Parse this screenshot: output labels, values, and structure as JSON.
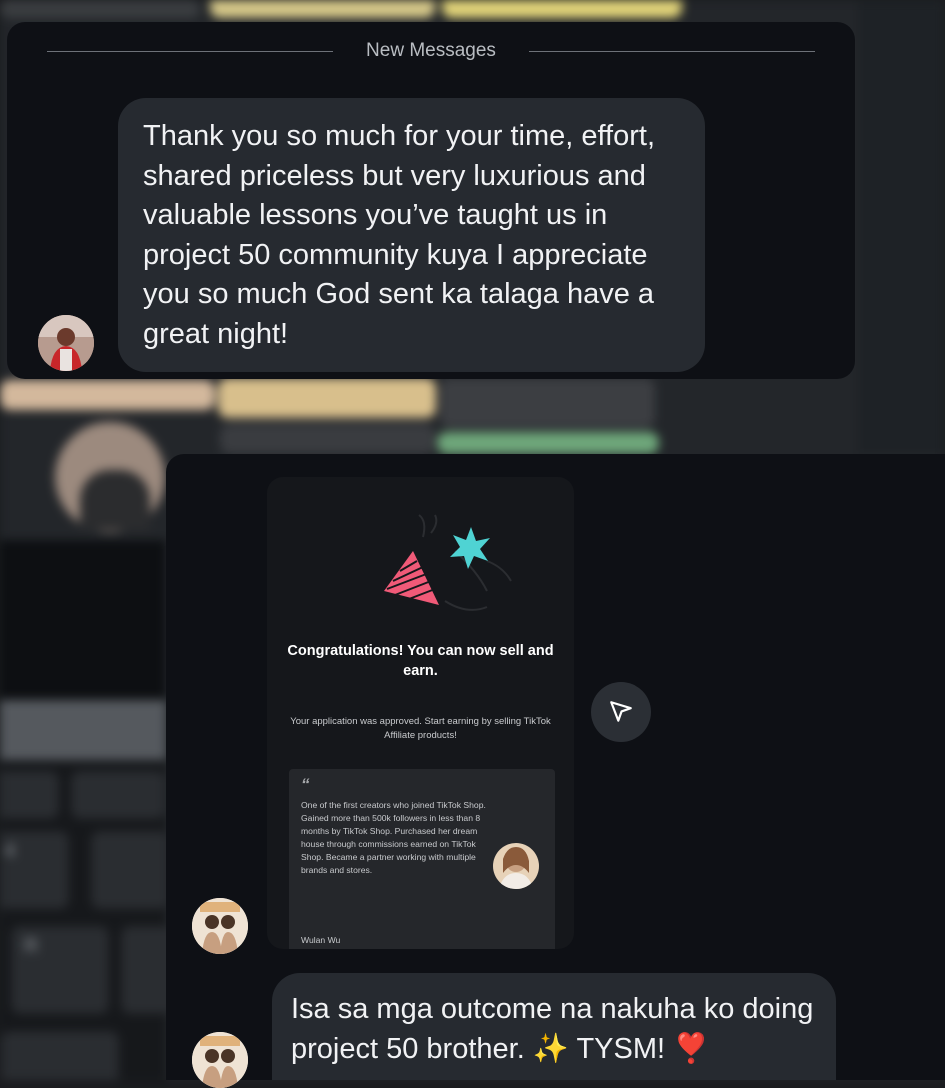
{
  "top_thread": {
    "divider_label": "New Messages",
    "message": "Thank you so much for your time, effort, shared priceless but very luxurious and valuable lessons you’ve taught us in project 50 community kuya I appreciate you so much God sent ka talaga have a great night!"
  },
  "bottom_thread": {
    "shared_post": {
      "title": "Congratulations! You can now sell and earn.",
      "subtitle": "Your application was approved. Start earning by selling TikTok Affiliate products!",
      "quote_mark": "“",
      "quote": "One of the first creators who joined TikTok Shop. Gained more than 500k followers in less than 8 months by TikTok Shop. Purchased her dream house through commissions earned on TikTok Shop. Became a partner working with multiple brands and stores.",
      "quote_author": "Wulan Wu"
    },
    "message": "Isa sa mga outcome na nakuha ko doing project 50 brother. ✨ TYSM! ❣️"
  },
  "icons": {
    "share": "paper-plane-icon",
    "star": "confetti-star-icon",
    "party": "party-hat-icon"
  },
  "colors": {
    "card_bg": "#0e1015",
    "bubble_bg": "#262a30",
    "accent_pink": "#f05a78",
    "accent_teal": "#4fd3d3"
  }
}
